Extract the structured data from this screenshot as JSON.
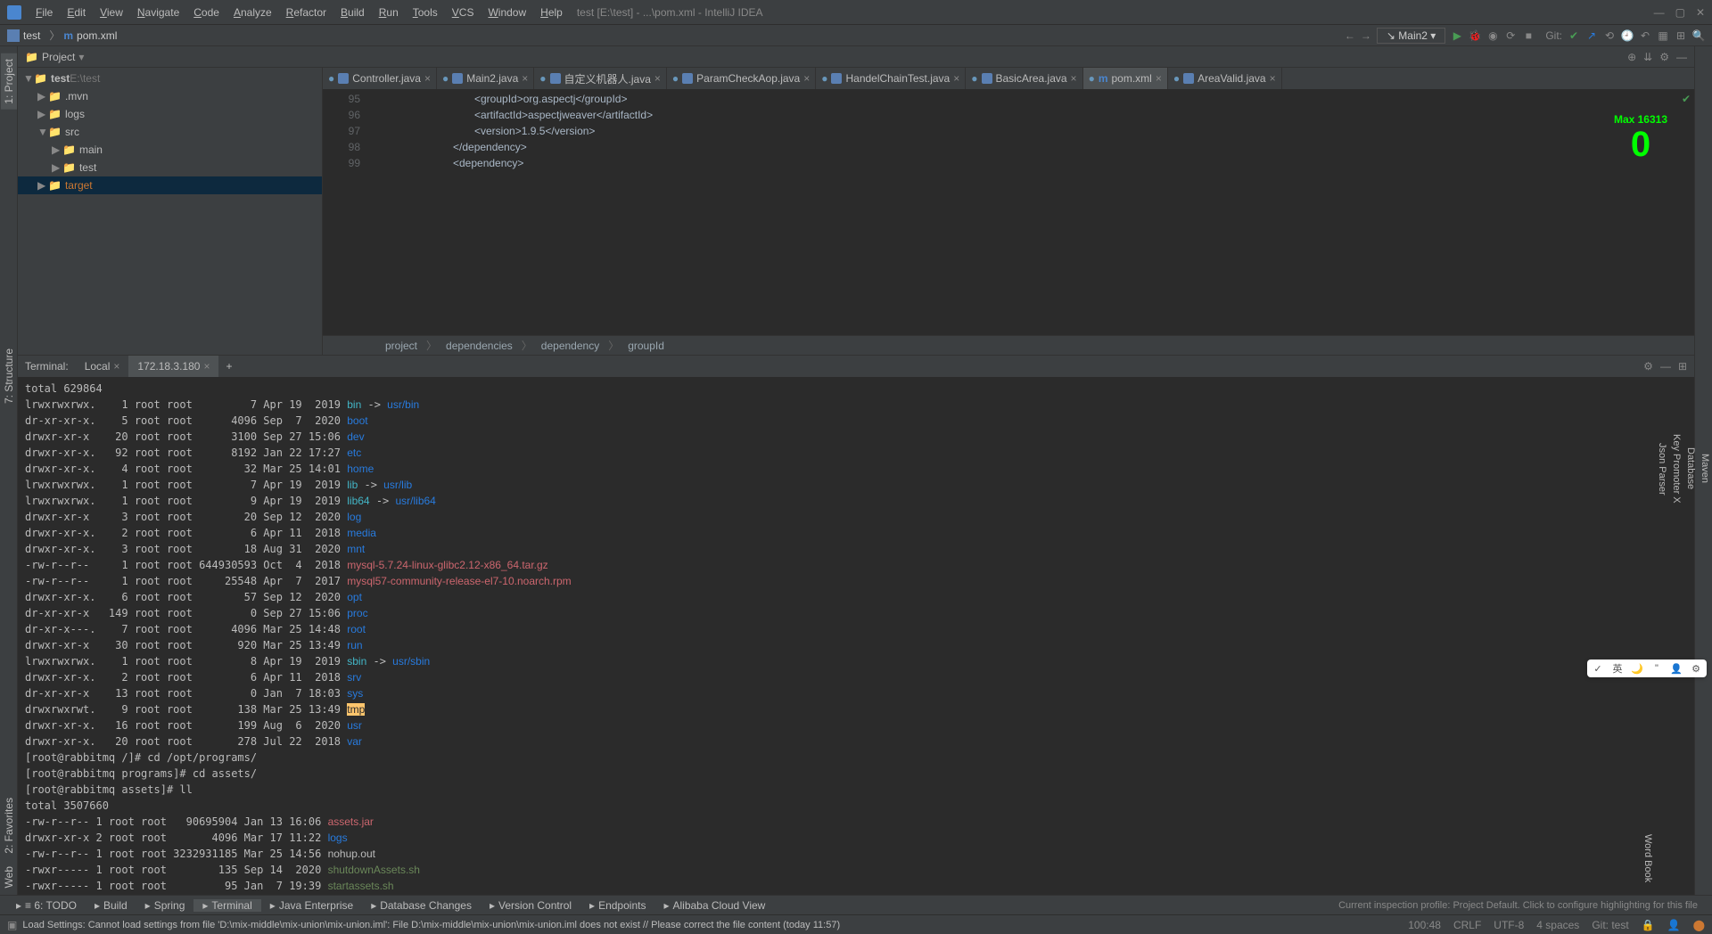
{
  "app": {
    "title": "test [E:\\test] - ...\\pom.xml - IntelliJ IDEA",
    "menus": [
      "File",
      "Edit",
      "View",
      "Navigate",
      "Code",
      "Analyze",
      "Refactor",
      "Build",
      "Run",
      "Tools",
      "VCS",
      "Window",
      "Help"
    ]
  },
  "nav": {
    "project_icon": "test",
    "file_icon": "m",
    "file_name": "pom.xml",
    "run_config": "Main2",
    "git_label": "Git:"
  },
  "project_panel": {
    "title": "Project",
    "tree": [
      {
        "level": 0,
        "arrow": "▼",
        "icon": "📁",
        "label": "test",
        "suffix": "E:\\test",
        "bold": true
      },
      {
        "level": 1,
        "arrow": "▶",
        "icon": "📁",
        "label": ".mvn"
      },
      {
        "level": 1,
        "arrow": "▶",
        "icon": "📁",
        "label": "logs"
      },
      {
        "level": 1,
        "arrow": "▼",
        "icon": "📁",
        "label": "src"
      },
      {
        "level": 2,
        "arrow": "▶",
        "icon": "📁",
        "label": "main"
      },
      {
        "level": 2,
        "arrow": "▶",
        "icon": "📁",
        "label": "test"
      },
      {
        "level": 1,
        "arrow": "▶",
        "icon": "📁",
        "label": "target",
        "selected": true,
        "orange": true
      }
    ]
  },
  "editor": {
    "tabs": [
      {
        "icon": "java",
        "label": "Controller.java"
      },
      {
        "icon": "java",
        "label": "Main2.java"
      },
      {
        "icon": "java",
        "label": "自定义机器人.java"
      },
      {
        "icon": "java",
        "label": "ParamCheckAop.java"
      },
      {
        "icon": "java",
        "label": "HandelChainTest.java"
      },
      {
        "icon": "java",
        "label": "BasicArea.java"
      },
      {
        "icon": "maven",
        "label": "pom.xml",
        "active": true
      },
      {
        "icon": "java",
        "label": "AreaValid.java"
      }
    ],
    "line_start": 95,
    "lines": [
      {
        "indent": 20,
        "text": "<groupId>org.aspectj</groupId>"
      },
      {
        "indent": 20,
        "text": "<artifactId>aspectjweaver</artifactId>"
      },
      {
        "indent": 20,
        "text": "<version>1.9.5</version>"
      },
      {
        "indent": 16,
        "text": "</dependency>"
      },
      {
        "indent": 16,
        "text": "<dependency>"
      }
    ],
    "breadcrumb": [
      "project",
      "dependencies",
      "dependency",
      "groupId"
    ],
    "overlay": {
      "line1": "Max  16313",
      "line2": "0"
    }
  },
  "terminal": {
    "title": "Terminal:",
    "tabs": [
      "Local",
      "172.18.3.180"
    ],
    "active_tab": 1,
    "listing_header": "total 629864",
    "rows": [
      {
        "perm": "lrwxrwxrwx.",
        "links": "1",
        "own": "root root",
        "size": "7",
        "date": "Apr 19  2019",
        "name": "bin",
        "arrow": " -> ",
        "target": "usr/bin",
        "color": "cyan",
        "tcolor": "blue"
      },
      {
        "perm": "dr-xr-xr-x.",
        "links": "5",
        "own": "root root",
        "size": "4096",
        "date": "Sep  7  2020",
        "name": "boot",
        "color": "blue"
      },
      {
        "perm": "drwxr-xr-x",
        "links": "20",
        "own": "root root",
        "size": "3100",
        "date": "Sep 27 15:06",
        "name": "dev",
        "color": "blue"
      },
      {
        "perm": "drwxr-xr-x.",
        "links": "92",
        "own": "root root",
        "size": "8192",
        "date": "Jan 22 17:27",
        "name": "etc",
        "color": "blue"
      },
      {
        "perm": "drwxr-xr-x.",
        "links": "4",
        "own": "root root",
        "size": "32",
        "date": "Mar 25 14:01",
        "name": "home",
        "color": "blue"
      },
      {
        "perm": "lrwxrwxrwx.",
        "links": "1",
        "own": "root root",
        "size": "7",
        "date": "Apr 19  2019",
        "name": "lib",
        "arrow": " -> ",
        "target": "usr/lib",
        "color": "cyan",
        "tcolor": "blue"
      },
      {
        "perm": "lrwxrwxrwx.",
        "links": "1",
        "own": "root root",
        "size": "9",
        "date": "Apr 19  2019",
        "name": "lib64",
        "arrow": " -> ",
        "target": "usr/lib64",
        "color": "cyan",
        "tcolor": "blue"
      },
      {
        "perm": "drwxr-xr-x",
        "links": "3",
        "own": "root root",
        "size": "20",
        "date": "Sep 12  2020",
        "name": "log",
        "color": "blue"
      },
      {
        "perm": "drwxr-xr-x.",
        "links": "2",
        "own": "root root",
        "size": "6",
        "date": "Apr 11  2018",
        "name": "media",
        "color": "blue"
      },
      {
        "perm": "drwxr-xr-x.",
        "links": "3",
        "own": "root root",
        "size": "18",
        "date": "Aug 31  2020",
        "name": "mnt",
        "color": "blue"
      },
      {
        "perm": "-rw-r--r--",
        "links": "1",
        "own": "root root",
        "size": "644930593",
        "date": "Oct  4  2018",
        "name": "mysql-5.7.24-linux-glibc2.12-x86_64.tar.gz",
        "color": "red"
      },
      {
        "perm": "-rw-r--r--",
        "links": "1",
        "own": "root root",
        "size": "25548",
        "date": "Apr  7  2017",
        "name": "mysql57-community-release-el7-10.noarch.rpm",
        "color": "red"
      },
      {
        "perm": "drwxr-xr-x.",
        "links": "6",
        "own": "root root",
        "size": "57",
        "date": "Sep 12  2020",
        "name": "opt",
        "color": "blue"
      },
      {
        "perm": "dr-xr-xr-x",
        "links": "149",
        "own": "root root",
        "size": "0",
        "date": "Sep 27 15:06",
        "name": "proc",
        "color": "blue"
      },
      {
        "perm": "dr-xr-x---.",
        "links": "7",
        "own": "root root",
        "size": "4096",
        "date": "Mar 25 14:48",
        "name": "root",
        "color": "blue"
      },
      {
        "perm": "drwxr-xr-x",
        "links": "30",
        "own": "root root",
        "size": "920",
        "date": "Mar 25 13:49",
        "name": "run",
        "color": "blue"
      },
      {
        "perm": "lrwxrwxrwx.",
        "links": "1",
        "own": "root root",
        "size": "8",
        "date": "Apr 19  2019",
        "name": "sbin",
        "arrow": " -> ",
        "target": "usr/sbin",
        "color": "cyan",
        "tcolor": "blue"
      },
      {
        "perm": "drwxr-xr-x.",
        "links": "2",
        "own": "root root",
        "size": "6",
        "date": "Apr 11  2018",
        "name": "srv",
        "color": "blue"
      },
      {
        "perm": "dr-xr-xr-x",
        "links": "13",
        "own": "root root",
        "size": "0",
        "date": "Jan  7 18:03",
        "name": "sys",
        "color": "blue"
      },
      {
        "perm": "drwxrwxrwt.",
        "links": "9",
        "own": "root root",
        "size": "138",
        "date": "Mar 25 13:49",
        "name": "tmp",
        "color": "hl",
        "bgyellow": true
      },
      {
        "perm": "drwxr-xr-x.",
        "links": "16",
        "own": "root root",
        "size": "199",
        "date": "Aug  6  2020",
        "name": "usr",
        "color": "blue"
      },
      {
        "perm": "drwxr-xr-x.",
        "links": "20",
        "own": "root root",
        "size": "278",
        "date": "Jul 22  2018",
        "name": "var",
        "color": "blue"
      }
    ],
    "commands": [
      "[root@rabbitmq /]# cd /opt/programs/",
      "[root@rabbitmq programs]# cd assets/",
      "[root@rabbitmq assets]# ll",
      "total 3507660"
    ],
    "listing2": [
      {
        "perm": "-rw-r--r-- 1 root root   90695904 Jan 13 16:06 ",
        "name": "assets.jar",
        "color": "red"
      },
      {
        "perm": "drwxr-xr-x 2 root root       4096 Mar 17 11:22 ",
        "name": "logs",
        "color": "blue"
      },
      {
        "perm": "-rw-r--r-- 1 root root 3232931185 Mar 25 14:56 ",
        "name": "nohup.out",
        "color": ""
      },
      {
        "perm": "-rwxr----- 1 root root        135 Sep 14  2020 ",
        "name": "shutdownAssets.sh",
        "color": "green"
      },
      {
        "perm": "-rwxr----- 1 root root         95 Jan  7 19:39 ",
        "name": "startassets.sh",
        "color": "green"
      }
    ]
  },
  "bottom_tabs": [
    "≡ 6: TODO",
    "Build",
    "Spring",
    "Terminal",
    "Java Enterprise",
    "Database Changes",
    "Version Control",
    "Endpoints",
    "Alibaba Cloud View"
  ],
  "bottom_right": "Current inspection profile: Project Default. Click to configure highlighting for this file",
  "status": {
    "msg": "Load Settings: Cannot load settings from file 'D:\\mix-middle\\mix-union\\mix-union.iml': File D:\\mix-middle\\mix-union\\mix-union.iml does not exist // Please correct the file content (today 11:57)",
    "pos": "100:48",
    "crlf": "CRLF",
    "encoding": "UTF-8",
    "indent": "4 spaces",
    "git": "Git: test"
  },
  "left_tabs": [
    "1: Project",
    "7: Structure",
    "2: Favorites",
    "Web"
  ],
  "right_tabs": [
    "Maven",
    "Database",
    "Key Promoter X",
    "Json Parser",
    "Word Book"
  ]
}
